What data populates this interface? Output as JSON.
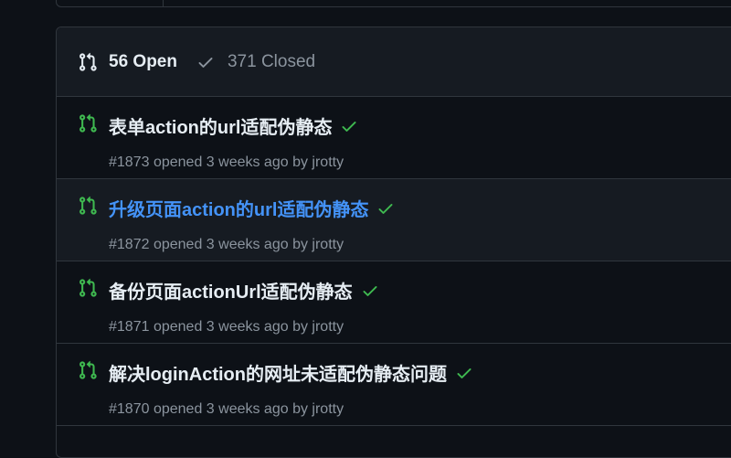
{
  "colors": {
    "open_green": "#3fb950",
    "check_green": "#3fb950",
    "link_blue": "#4493f8",
    "muted": "#8b949e",
    "border": "#30363d"
  },
  "header": {
    "open_count_label": "56 Open",
    "closed_count_label": "371 Closed",
    "open_icon": "git-pull-request-icon",
    "closed_icon": "check-icon"
  },
  "pull_requests": [
    {
      "title": "表单action的url适配伪静态",
      "number": "#1873",
      "opened": "opened 3 weeks ago by",
      "author": "jrotty",
      "status_icon": "check-icon"
    },
    {
      "title": "升级页面action的url适配伪静态",
      "number": "#1872",
      "opened": "opened 3 weeks ago by",
      "author": "jrotty",
      "status_icon": "check-icon"
    },
    {
      "title": "备份页面actionUrl适配伪静态",
      "number": "#1871",
      "opened": "opened 3 weeks ago by",
      "author": "jrotty",
      "status_icon": "check-icon"
    },
    {
      "title": "解决loginAction的网址未适配伪静态问题",
      "number": "#1870",
      "opened": "opened 3 weeks ago by",
      "author": "jrotty",
      "status_icon": "check-icon"
    }
  ]
}
